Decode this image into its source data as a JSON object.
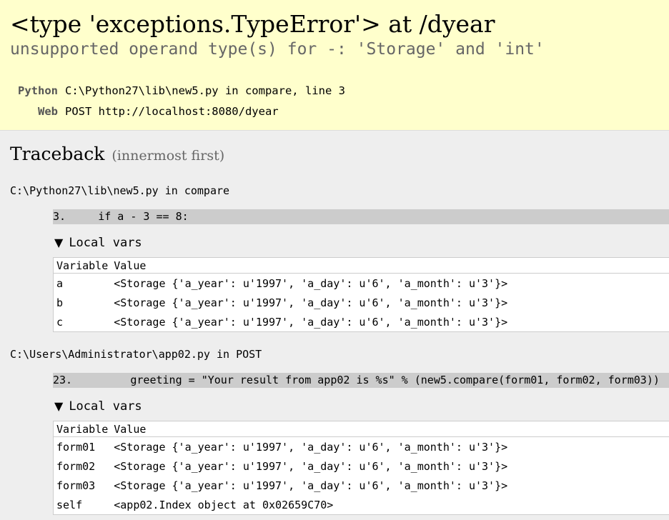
{
  "error": {
    "type_line": "<type 'exceptions.TypeError'> at /dyear",
    "message": "unsupported operand type(s) for -: 'Storage' and 'int'"
  },
  "meta": [
    {
      "key": "Python",
      "value": "C:\\Python27\\lib\\new5.py in compare, line 3"
    },
    {
      "key": "Web",
      "value": "POST http://localhost:8080/dyear"
    }
  ],
  "traceback": {
    "title": "Traceback",
    "subtitle": "(innermost first)",
    "local_vars_label": "Local vars",
    "col_variable": "Variable",
    "col_value": "Value",
    "frames": [
      {
        "file": "C:\\Python27\\lib\\new5.py in compare",
        "code": "3.     if a - 3 == 8:",
        "vars": [
          {
            "name": "a",
            "value": "<Storage {'a_year': u'1997', 'a_day': u'6', 'a_month': u'3'}>"
          },
          {
            "name": "b",
            "value": "<Storage {'a_year': u'1997', 'a_day': u'6', 'a_month': u'3'}>"
          },
          {
            "name": "c",
            "value": "<Storage {'a_year': u'1997', 'a_day': u'6', 'a_month': u'3'}>"
          }
        ]
      },
      {
        "file": "C:\\Users\\Administrator\\app02.py in POST",
        "code": "23.         greeting = \"Your result from app02 is %s\" % (new5.compare(form01, form02, form03))",
        "vars": [
          {
            "name": "form01",
            "value": "<Storage {'a_year': u'1997', 'a_day': u'6', 'a_month': u'3'}>"
          },
          {
            "name": "form02",
            "value": "<Storage {'a_year': u'1997', 'a_day': u'6', 'a_month': u'3'}>"
          },
          {
            "name": "form03",
            "value": "<Storage {'a_year': u'1997', 'a_day': u'6', 'a_month': u'3'}>"
          },
          {
            "name": "self",
            "value": "<app02.Index object at 0x02659C70>"
          }
        ]
      }
    ]
  }
}
